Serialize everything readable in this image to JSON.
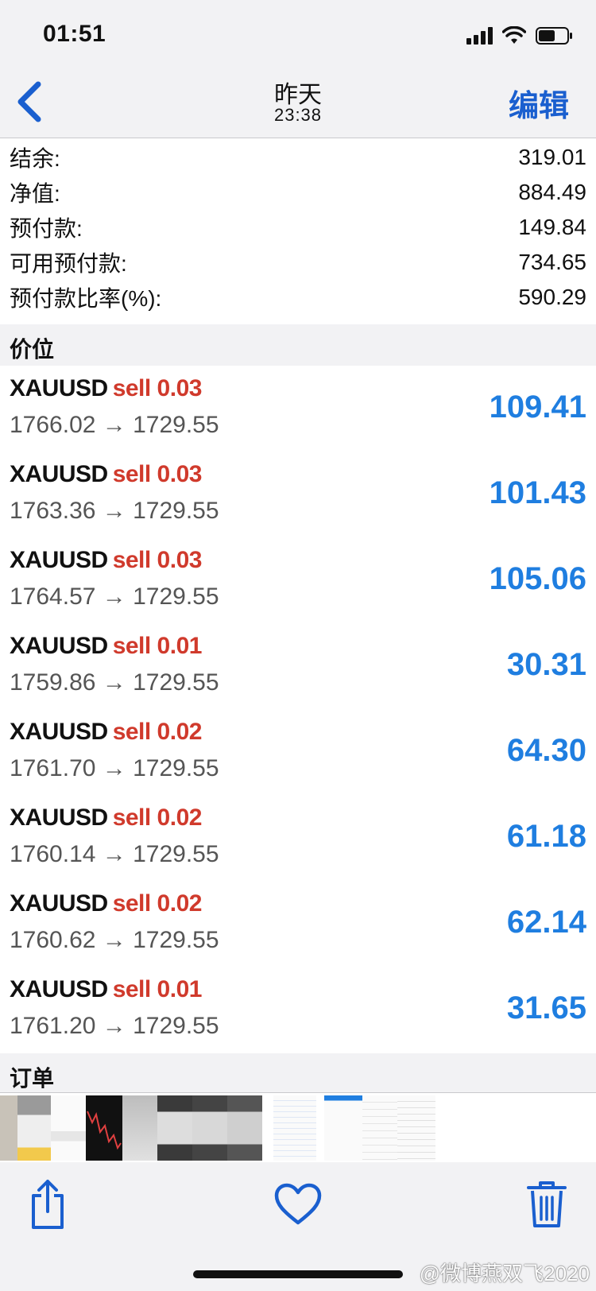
{
  "status_bar": {
    "time": "01:51"
  },
  "nav": {
    "title": "昨天",
    "subtitle": "23:38",
    "edit_label": "编辑"
  },
  "summary": [
    {
      "label": "结余:",
      "value": "319.01"
    },
    {
      "label": "净值:",
      "value": "884.49"
    },
    {
      "label": "预付款:",
      "value": "149.84"
    },
    {
      "label": "可用预付款:",
      "value": "734.65"
    },
    {
      "label": "预付款比率(%):",
      "value": "590.29"
    }
  ],
  "sections": {
    "positions": "价位",
    "orders": "订单"
  },
  "positions": [
    {
      "symbol": "XAUUSD",
      "side": "sell 0.03",
      "prices": "1766.02 → 1729.55",
      "profit": "109.41"
    },
    {
      "symbol": "XAUUSD",
      "side": "sell 0.03",
      "prices": "1763.36 → 1729.55",
      "profit": "101.43"
    },
    {
      "symbol": "XAUUSD",
      "side": "sell 0.03",
      "prices": "1764.57 → 1729.55",
      "profit": "105.06"
    },
    {
      "symbol": "XAUUSD",
      "side": "sell 0.01",
      "prices": "1759.86 → 1729.55",
      "profit": "30.31"
    },
    {
      "symbol": "XAUUSD",
      "side": "sell 0.02",
      "prices": "1761.70 → 1729.55",
      "profit": "64.30"
    },
    {
      "symbol": "XAUUSD",
      "side": "sell 0.02",
      "prices": "1760.14 → 1729.55",
      "profit": "61.18"
    },
    {
      "symbol": "XAUUSD",
      "side": "sell 0.02",
      "prices": "1760.62 → 1729.55",
      "profit": "62.14"
    },
    {
      "symbol": "XAUUSD",
      "side": "sell 0.01",
      "prices": "1761.20 → 1729.55",
      "profit": "31.65"
    }
  ],
  "toolbar": {
    "share": "share-icon",
    "favorite": "heart-icon",
    "delete": "trash-icon"
  },
  "watermark": "@微博燕双飞2020",
  "colors": {
    "accent": "#1a5fcf",
    "profit": "#1f7ee0",
    "sell": "#d03a2c"
  }
}
